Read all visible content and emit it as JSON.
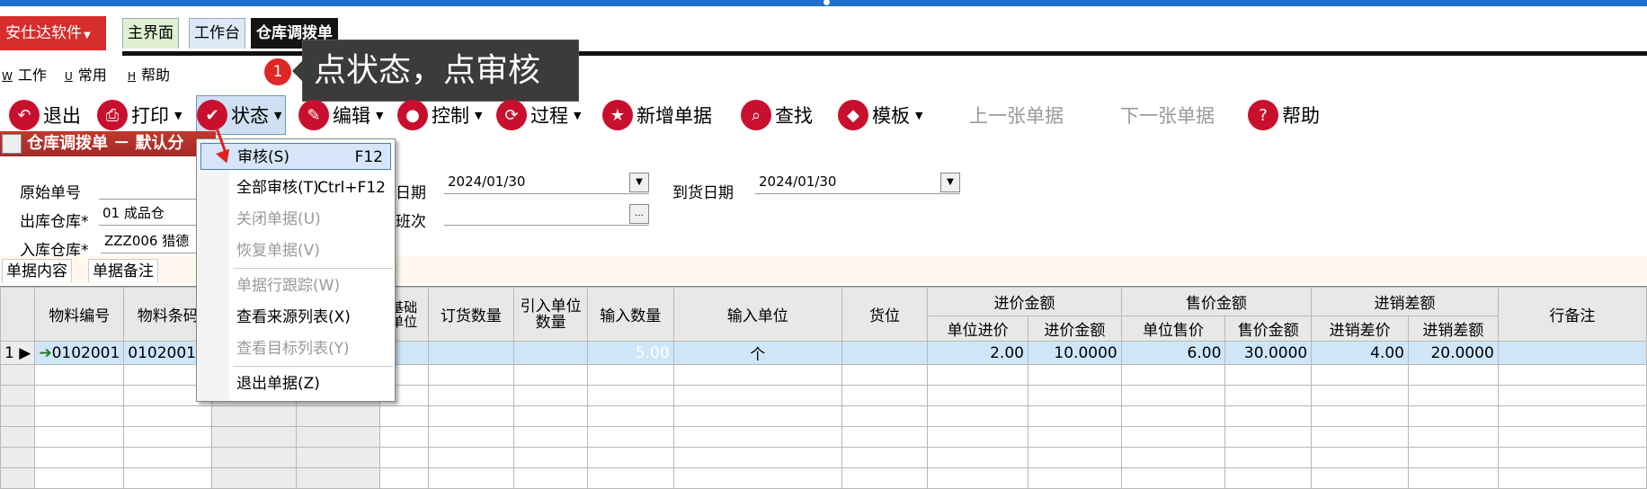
{
  "app": {
    "brand": "安仕达软件",
    "nav_tabs": [
      "主界面",
      "工作台",
      "仓库调拨单"
    ]
  },
  "menubar": [
    {
      "key": "W",
      "label": "工作"
    },
    {
      "key": "U",
      "label": "常用"
    },
    {
      "key": "H",
      "label": "帮助"
    }
  ],
  "tooltip": {
    "badge": "1",
    "text": "点状态，点审核"
  },
  "toolbar": {
    "exit": "退出",
    "print": "打印",
    "state": "状态",
    "edit": "编辑",
    "control": "控制",
    "process": "过程",
    "new_doc": "新增单据",
    "find": "查找",
    "template": "模板",
    "prev_doc": "上一张单据",
    "next_doc": "下一张单据",
    "help": "帮助"
  },
  "form": {
    "title": "仓库调拨单 － 默认分",
    "orig_no_label": "原始单号",
    "out_wh_label": "出库仓库*",
    "out_wh_value": "01 成品仓",
    "in_wh_label": "入库仓库*",
    "in_wh_value": "ZZZ006 猎德",
    "date_label": "日期",
    "date_value": "2024/01/30",
    "shift_label": "班次",
    "arrival_label": "到货日期",
    "arrival_value": "2024/01/30"
  },
  "tabs": [
    "单据内容",
    "单据备注"
  ],
  "table": {
    "headers": {
      "code": "物料编号",
      "barcode": "物料条码",
      "base_unit": "基础单位",
      "order_qty": "订货数量",
      "ref_qty": "引入单位数量",
      "input_qty": "输入数量",
      "input_unit": "输入单位",
      "location": "货位",
      "cost_group": "进价金额",
      "unit_cost": "单位进价",
      "cost_amt": "进价金额",
      "sale_group": "售价金额",
      "unit_sale": "单位售价",
      "sale_amt": "售价金额",
      "diff_group": "进销差额",
      "diff_price": "进销差价",
      "diff_amt": "进销差额",
      "remark": "行备注"
    },
    "row1": {
      "no": "1",
      "code": "0102001",
      "barcode": "01020017",
      "input_qty": "5.00",
      "input_unit": "个",
      "unit_cost": "2.00",
      "cost_amt": "10.0000",
      "unit_sale": "6.00",
      "sale_amt": "30.0000",
      "diff_price": "4.00",
      "diff_amt": "20.0000"
    }
  },
  "context_menu": [
    {
      "label": "审核(S)",
      "shortcut": "F12",
      "state": "highlight"
    },
    {
      "label": "全部审核(T)",
      "shortcut": "Ctrl+F12",
      "state": "enabled"
    },
    {
      "label": "关闭单据(U)",
      "shortcut": "",
      "state": "disabled"
    },
    {
      "label": "恢复单据(V)",
      "shortcut": "",
      "state": "disabled"
    },
    {
      "label": "单据行跟踪(W)",
      "shortcut": "",
      "state": "disabled"
    },
    {
      "label": "查看来源列表(X)",
      "shortcut": "",
      "state": "enabled"
    },
    {
      "label": "查看目标列表(Y)",
      "shortcut": "",
      "state": "disabled"
    },
    {
      "label": "退出单据(Z)",
      "shortcut": "",
      "state": "enabled"
    }
  ],
  "colors": {
    "accent_red": "#c8102e",
    "selection_blue": "#1060c8",
    "title_bar": "#1e6fc8"
  }
}
